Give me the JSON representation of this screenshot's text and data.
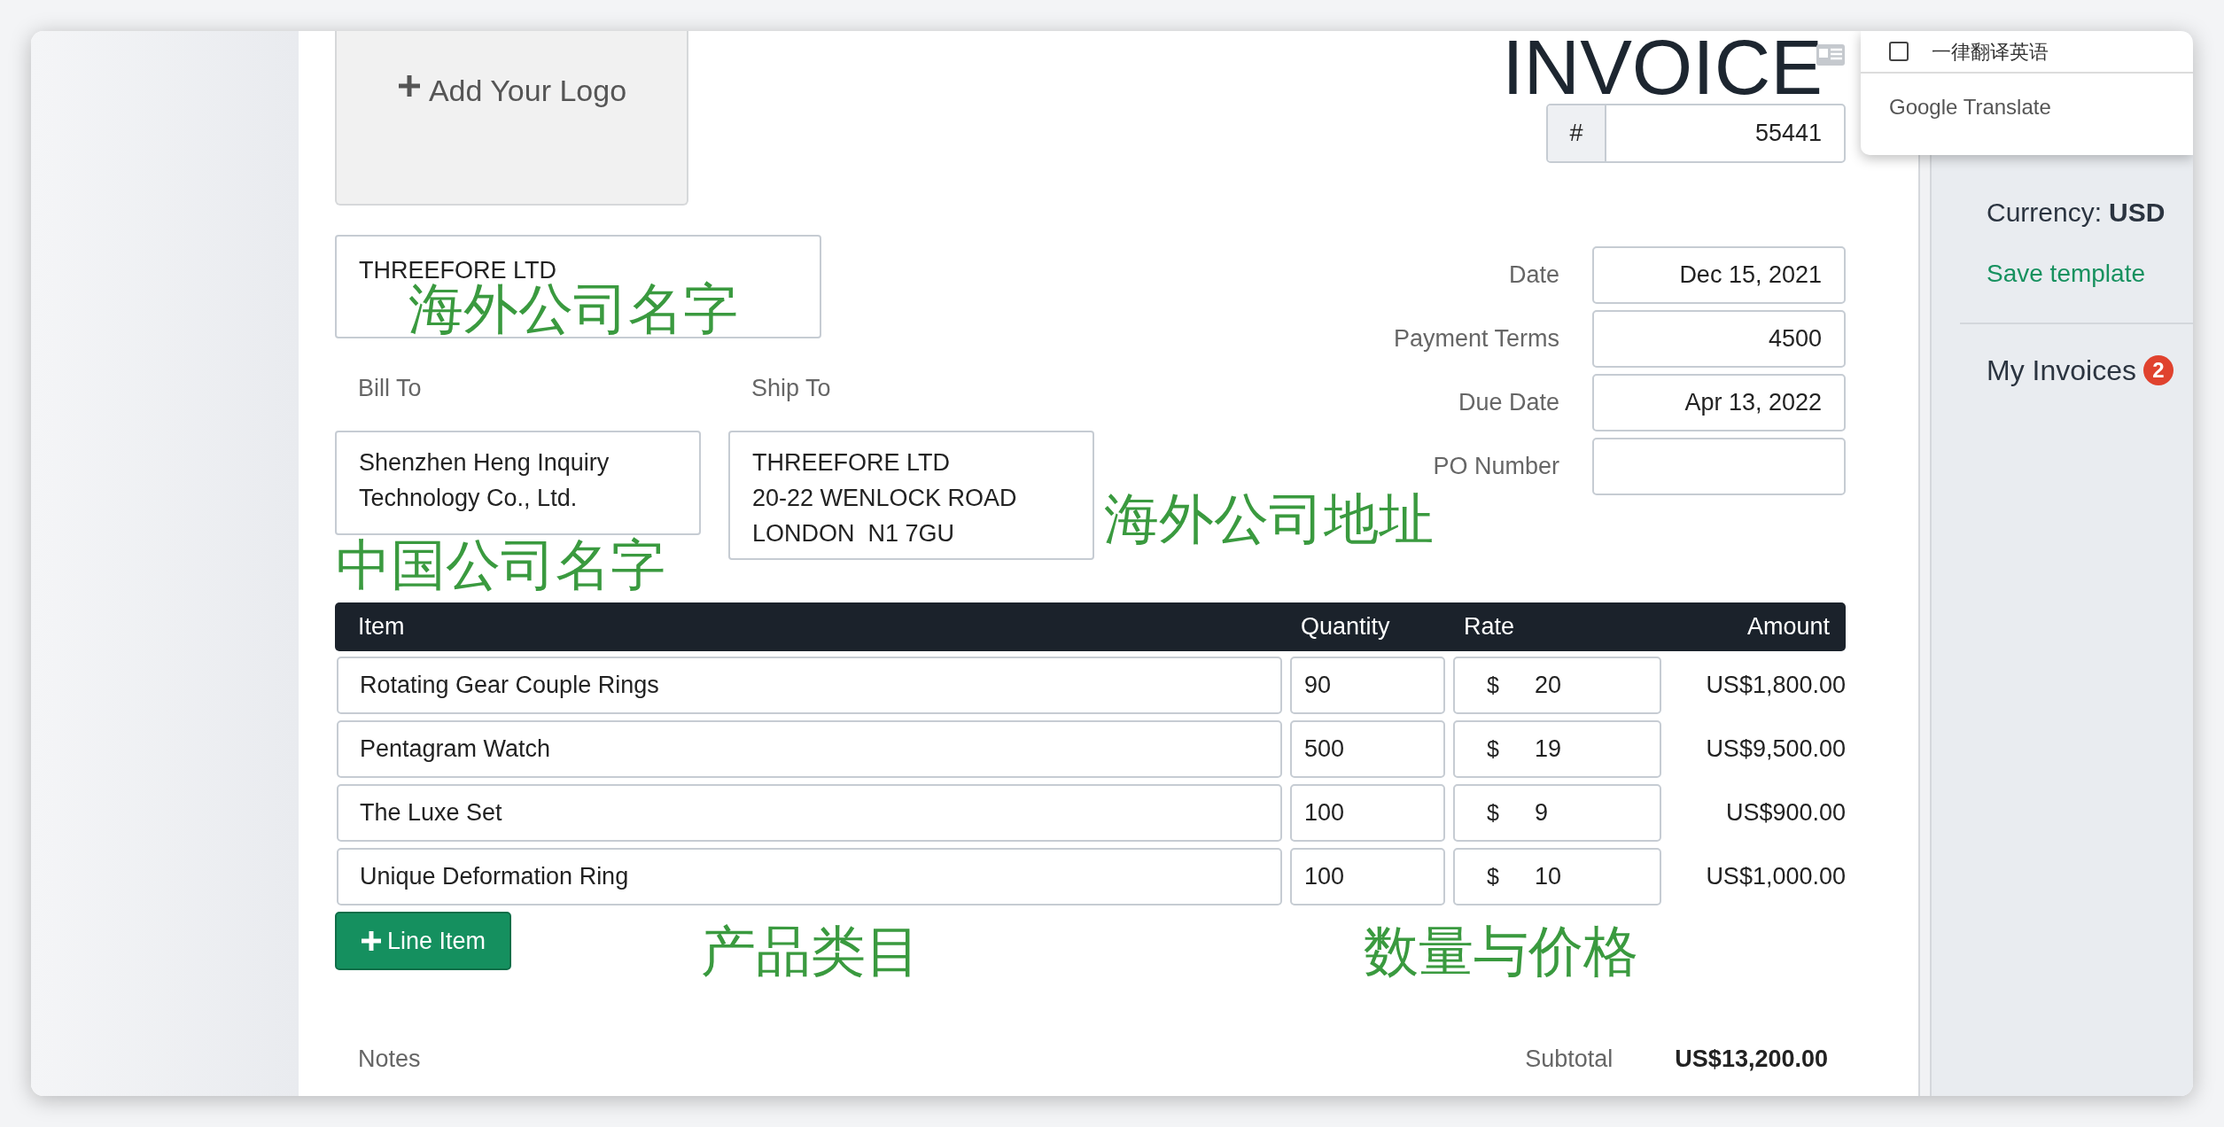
{
  "logo_box": {
    "label": "Add Your Logo"
  },
  "title": "INVOICE",
  "invoice_number": {
    "prefix": "#",
    "value": "55441"
  },
  "from": {
    "value": "THREEFORE LTD"
  },
  "bill_to": {
    "label": "Bill To",
    "lines": [
      "Shenzhen Heng Inquiry",
      "Technology Co., Ltd."
    ]
  },
  "ship_to": {
    "label": "Ship To",
    "lines": [
      "THREEFORE LTD",
      "20-22 WENLOCK ROAD",
      "LONDON  N1 7GU"
    ]
  },
  "meta": [
    {
      "label": "Date",
      "value": "Dec 15, 2021"
    },
    {
      "label": "Payment Terms",
      "value": "4500"
    },
    {
      "label": "Due Date",
      "value": "Apr 13, 2022"
    },
    {
      "label": "PO Number"
    }
  ],
  "table": {
    "columns": [
      "Item",
      "Quantity",
      "Rate",
      "Amount"
    ],
    "rows": [
      {
        "item": "Rotating Gear Couple Rings",
        "quantity": "90",
        "currency": "$",
        "rate": "20",
        "amount": "US$1,800.00"
      },
      {
        "item": "Pentagram Watch",
        "quantity": "500",
        "currency": "$",
        "rate": "19",
        "amount": "US$9,500.00"
      },
      {
        "item": "The Luxe Set",
        "quantity": "100",
        "currency": "$",
        "rate": "9",
        "amount": "US$900.00"
      },
      {
        "item": "Unique Deformation Ring",
        "quantity": "100",
        "currency": "$",
        "rate": "10",
        "amount": "US$1,000.00"
      }
    ]
  },
  "add_line_button": "Line Item",
  "notes_label": "Notes",
  "subtotal": {
    "label": "Subtotal",
    "value": "US$13,200.00"
  },
  "sidebar": {
    "currency_label": "Currency:",
    "currency": "USD",
    "save_template": "Save template",
    "my_invoices": "My Invoices",
    "badge": "2"
  },
  "translate_popup": {
    "option": "一律翻译英语",
    "checked": false,
    "brand": "Google Translate"
  },
  "annotations": [
    {
      "text": "海外公司名字"
    },
    {
      "text": "中国公司名字"
    },
    {
      "text": "海外公司地址"
    },
    {
      "text": "产品类目"
    },
    {
      "text": "数量与价格"
    }
  ]
}
